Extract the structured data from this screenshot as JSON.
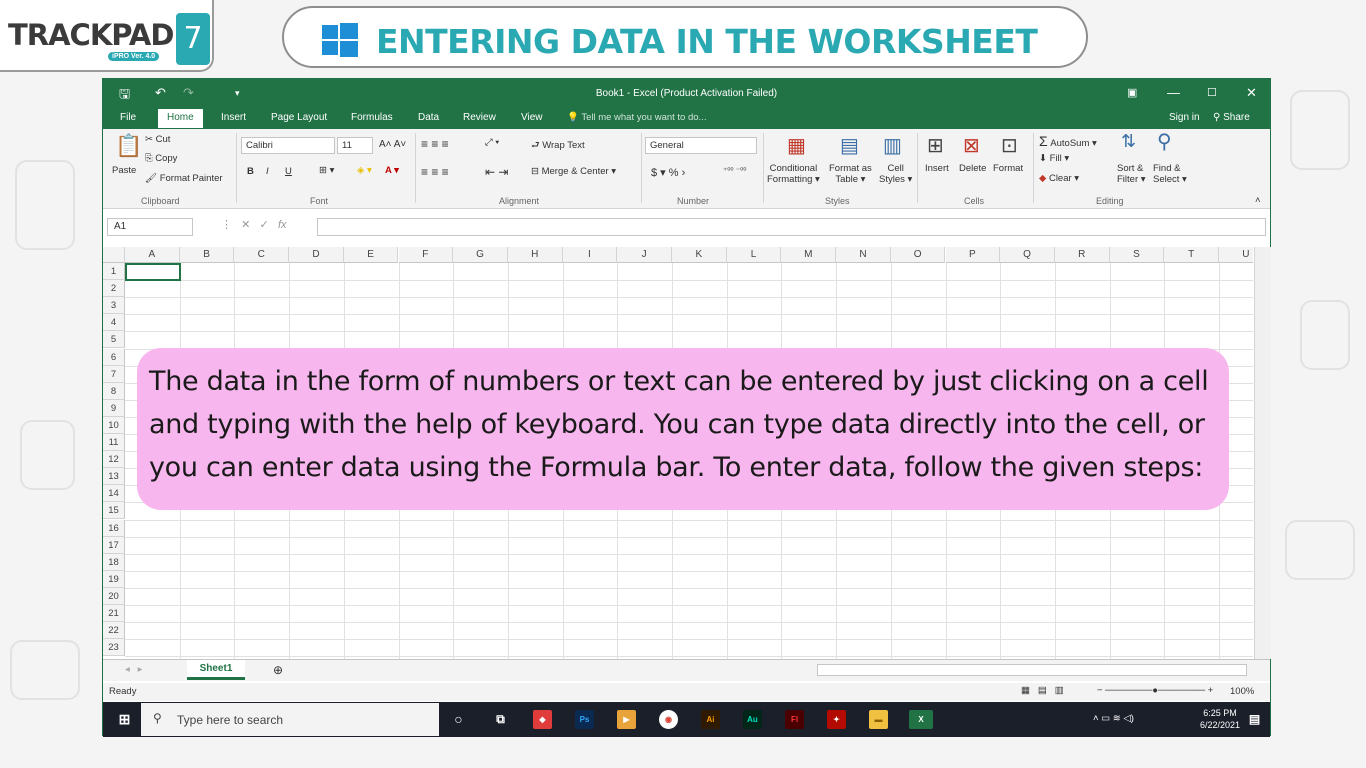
{
  "logo": {
    "brand": "TRACKPAD",
    "version_tag": "iPRO Ver. 4.0",
    "number": "7"
  },
  "banner": {
    "title": "ENTERING DATA IN THE WORKSHEET"
  },
  "excel": {
    "window_title": "Book1 - Excel (Product Activation Failed)",
    "menu": [
      "File",
      "Home",
      "Insert",
      "Page Layout",
      "Formulas",
      "Data",
      "Review",
      "View"
    ],
    "tell_me": "Tell me what you want to do...",
    "sign_in": "Sign in",
    "share": "Share",
    "clipboard": {
      "paste": "Paste",
      "cut": "Cut",
      "copy": "Copy",
      "format_painter": "Format Painter",
      "label": "Clipboard"
    },
    "font": {
      "name": "Calibri",
      "size": "11",
      "label": "Font"
    },
    "alignment": {
      "wrap_text": "Wrap Text",
      "merge_center": "Merge & Center",
      "label": "Alignment"
    },
    "number": {
      "format": "General",
      "label": "Number"
    },
    "styles": {
      "conditional": "Conditional",
      "formatting": "Formatting",
      "format_as": "Format as",
      "table": "Table",
      "cell": "Cell",
      "styles_btn": "Styles",
      "label": "Styles"
    },
    "cells": {
      "insert": "Insert",
      "delete": "Delete",
      "format": "Format",
      "label": "Cells"
    },
    "editing": {
      "autosum": "AutoSum",
      "fill": "Fill",
      "clear": "Clear",
      "sort": "Sort &",
      "filter": "Filter",
      "find": "Find &",
      "select": "Select",
      "label": "Editing"
    },
    "name_box": "A1",
    "columns": [
      "A",
      "B",
      "C",
      "D",
      "E",
      "F",
      "G",
      "H",
      "I",
      "J",
      "K",
      "L",
      "M",
      "N",
      "O",
      "P",
      "Q",
      "R",
      "S",
      "T",
      "U"
    ],
    "rows": [
      "1",
      "2",
      "3",
      "4",
      "5",
      "6",
      "7",
      "8",
      "9",
      "10",
      "11",
      "12",
      "13",
      "14",
      "15",
      "16",
      "17",
      "18",
      "19",
      "20",
      "21",
      "22",
      "23"
    ],
    "sheet_tab": "Sheet1",
    "status": "Ready",
    "zoom": "100%"
  },
  "taskbar": {
    "search_placeholder": "Type here to search",
    "time": "6:25 PM",
    "date": "6/22/2021"
  },
  "callout": {
    "text": "The data in the form of numbers or text can be entered by just clicking on a cell and typing with the help of keyboard. You can type data directly into the cell, or you can enter data using the Formula bar. To enter data, follow the given steps:"
  }
}
